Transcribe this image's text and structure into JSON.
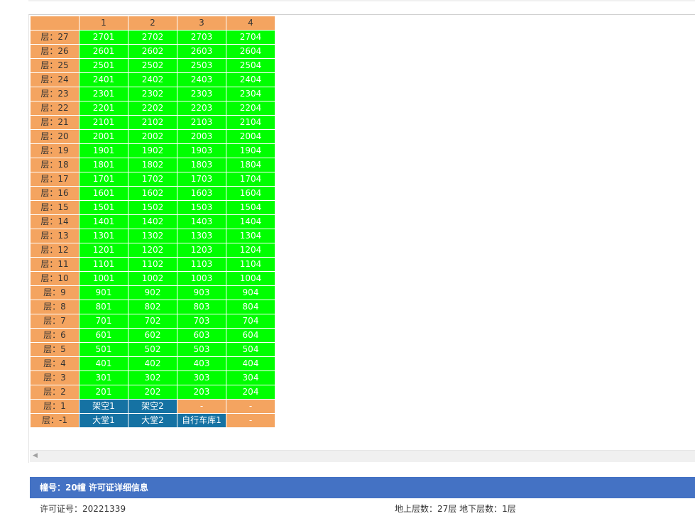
{
  "table": {
    "columns": [
      "1",
      "2",
      "3",
      "4"
    ],
    "rows": [
      {
        "floor": "层：27",
        "units": [
          "2701",
          "2702",
          "2703",
          "2704"
        ]
      },
      {
        "floor": "层：26",
        "units": [
          "2601",
          "2602",
          "2603",
          "2604"
        ]
      },
      {
        "floor": "层：25",
        "units": [
          "2501",
          "2502",
          "2503",
          "2504"
        ]
      },
      {
        "floor": "层：24",
        "units": [
          "2401",
          "2402",
          "2403",
          "2404"
        ]
      },
      {
        "floor": "层：23",
        "units": [
          "2301",
          "2302",
          "2303",
          "2304"
        ]
      },
      {
        "floor": "层：22",
        "units": [
          "2201",
          "2202",
          "2203",
          "2204"
        ]
      },
      {
        "floor": "层：21",
        "units": [
          "2101",
          "2102",
          "2103",
          "2104"
        ]
      },
      {
        "floor": "层：20",
        "units": [
          "2001",
          "2002",
          "2003",
          "2004"
        ]
      },
      {
        "floor": "层：19",
        "units": [
          "1901",
          "1902",
          "1903",
          "1904"
        ]
      },
      {
        "floor": "层：18",
        "units": [
          "1801",
          "1802",
          "1803",
          "1804"
        ]
      },
      {
        "floor": "层：17",
        "units": [
          "1701",
          "1702",
          "1703",
          "1704"
        ]
      },
      {
        "floor": "层：16",
        "units": [
          "1601",
          "1602",
          "1603",
          "1604"
        ]
      },
      {
        "floor": "层：15",
        "units": [
          "1501",
          "1502",
          "1503",
          "1504"
        ]
      },
      {
        "floor": "层：14",
        "units": [
          "1401",
          "1402",
          "1403",
          "1404"
        ]
      },
      {
        "floor": "层：13",
        "units": [
          "1301",
          "1302",
          "1303",
          "1304"
        ]
      },
      {
        "floor": "层：12",
        "units": [
          "1201",
          "1202",
          "1203",
          "1204"
        ]
      },
      {
        "floor": "层：11",
        "units": [
          "1101",
          "1102",
          "1103",
          "1104"
        ]
      },
      {
        "floor": "层：10",
        "units": [
          "1001",
          "1002",
          "1003",
          "1004"
        ]
      },
      {
        "floor": "层：9",
        "units": [
          "901",
          "902",
          "903",
          "904"
        ]
      },
      {
        "floor": "层：8",
        "units": [
          "801",
          "802",
          "803",
          "804"
        ]
      },
      {
        "floor": "层：7",
        "units": [
          "701",
          "702",
          "703",
          "704"
        ]
      },
      {
        "floor": "层：6",
        "units": [
          "601",
          "602",
          "603",
          "604"
        ]
      },
      {
        "floor": "层：5",
        "units": [
          "501",
          "502",
          "503",
          "504"
        ]
      },
      {
        "floor": "层：4",
        "units": [
          "401",
          "402",
          "403",
          "404"
        ]
      },
      {
        "floor": "层：3",
        "units": [
          "301",
          "302",
          "303",
          "304"
        ]
      },
      {
        "floor": "层：2",
        "units": [
          "201",
          "202",
          "203",
          "204"
        ]
      },
      {
        "floor": "层：1",
        "units": [
          "架空1",
          "架空2",
          "-",
          "-"
        ],
        "kinds": [
          "blue",
          "blue",
          "empty",
          "empty"
        ]
      },
      {
        "floor": "层：-1",
        "units": [
          "大堂1",
          "大堂2",
          "自行车库1",
          "-"
        ],
        "kinds": [
          "blue",
          "blue",
          "blue",
          "empty"
        ]
      }
    ]
  },
  "colors": {
    "available": "#00ff00",
    "special": "#1572a3",
    "header": "#f4a460",
    "info_bar": "#4472c4"
  },
  "scroll": {
    "left_arrow_icon": "◀"
  },
  "info": {
    "title": "幢号：20幢 许可证详细信息",
    "permit": "许可证号：20221339",
    "floors": "地上层数：27层  地下层数：1层"
  }
}
